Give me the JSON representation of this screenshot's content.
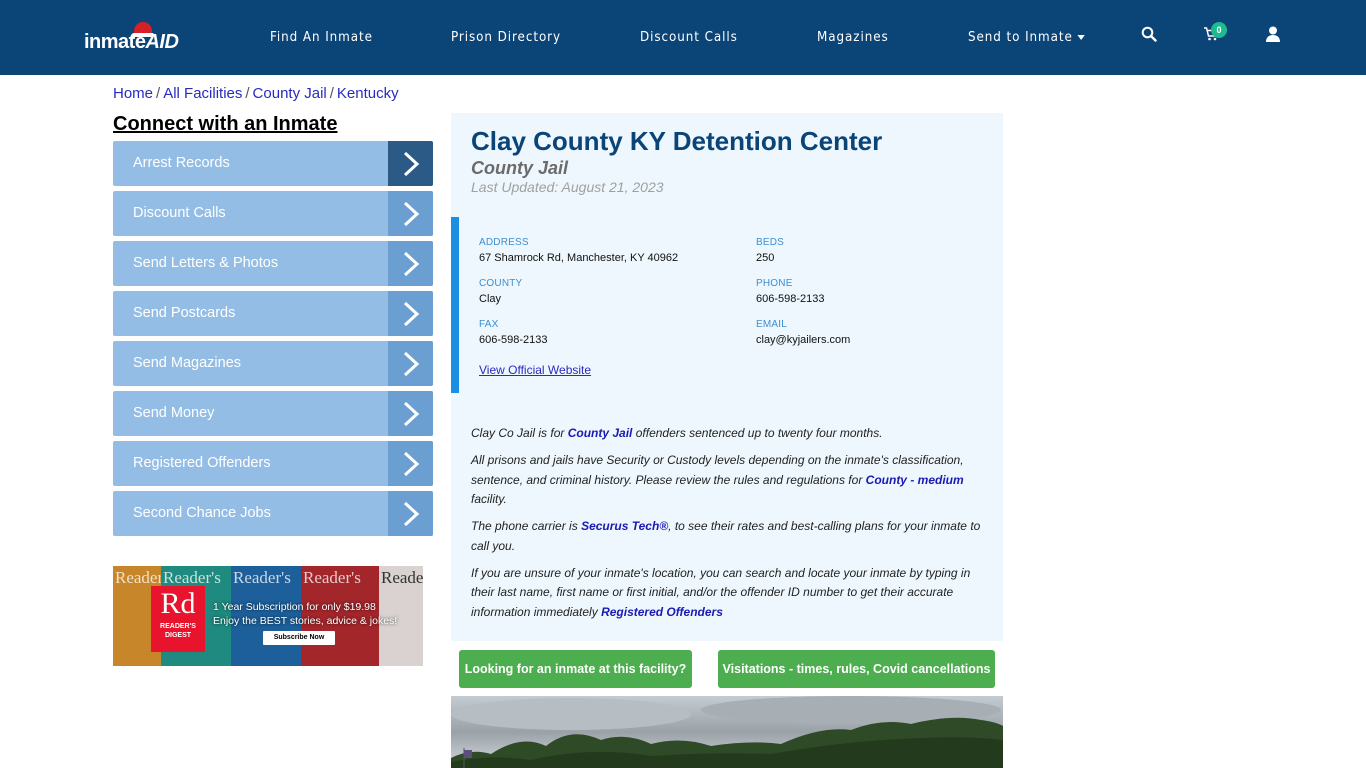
{
  "header": {
    "logo": {
      "text_main": "inmate",
      "text_accent": "AID"
    },
    "nav": [
      {
        "label": "Find An Inmate",
        "has_dropdown": false
      },
      {
        "label": "Prison Directory",
        "has_dropdown": false
      },
      {
        "label": "Discount Calls",
        "has_dropdown": false
      },
      {
        "label": "Magazines",
        "has_dropdown": false
      },
      {
        "label": "Send to Inmate",
        "has_dropdown": true
      }
    ],
    "icons": {
      "search": "search-icon",
      "cart": "cart-icon",
      "user": "user-icon"
    },
    "cart_count": "0",
    "colors": {
      "navbar_bg": "#0b4477",
      "badge": "#1dbb8f"
    }
  },
  "breadcrumb": {
    "items": [
      "Home",
      "All Facilities",
      "County Jail",
      "Kentucky"
    ],
    "separator": "/"
  },
  "sidebar": {
    "title": "Connect with an Inmate",
    "items": [
      {
        "label": "Arrest Records",
        "active": true
      },
      {
        "label": "Discount Calls",
        "active": false
      },
      {
        "label": "Send Letters & Photos",
        "active": false
      },
      {
        "label": "Send Postcards",
        "active": false
      },
      {
        "label": "Send Magazines",
        "active": false
      },
      {
        "label": "Send Money",
        "active": false
      },
      {
        "label": "Registered Offenders",
        "active": false
      },
      {
        "label": "Second Chance Jobs",
        "active": false
      }
    ],
    "ad": {
      "brand_big": "Rd",
      "brand_small_1": "READER'S",
      "brand_small_2": "DIGEST",
      "cover_title": "Reader's",
      "line1": "1 Year Subscription for only $19.98",
      "line2": "Enjoy the BEST stories, advice & jokes!",
      "cta": "Subscribe Now"
    }
  },
  "facility": {
    "name": "Clay County KY Detention Center",
    "type": "County Jail",
    "last_updated": "Last Updated: August 21, 2023",
    "info": {
      "address_label": "ADDRESS",
      "address": "67 Shamrock Rd, Manchester, KY 40962",
      "beds_label": "BEDS",
      "beds": "250",
      "county_label": "COUNTY",
      "county": "Clay",
      "phone_label": "PHONE",
      "phone": "606-598-2133",
      "fax_label": "FAX",
      "fax": "606-598-2133",
      "email_label": "EMAIL",
      "email": "clay@kyjailers.com",
      "website_link": "View Official Website"
    },
    "description": {
      "p1_before": "Clay Co Jail is for ",
      "p1_link": "County Jail",
      "p1_after": " offenders sentenced up to twenty four months.",
      "p2_before": "All prisons and jails have Security or Custody levels depending on the inmate's classification, sentence, and criminal history. Please review the rules and regulations for ",
      "p2_link": "County - medium",
      "p2_after": " facility.",
      "p3_before": "The phone carrier is ",
      "p3_link": "Securus Tech®",
      "p3_after": ", to see their rates and best-calling plans for your inmate to call you.",
      "p4_before": "If you are unsure of your inmate's location, you can search and locate your inmate by typing in their last name, first name or first initial, and/or the offender ID number to get their accurate information immediately ",
      "p4_link": "Registered Offenders"
    }
  },
  "actions": {
    "find_inmate": "Looking for an inmate at this facility?",
    "visitation": "Visitations - times, rules, Covid cancellations"
  }
}
